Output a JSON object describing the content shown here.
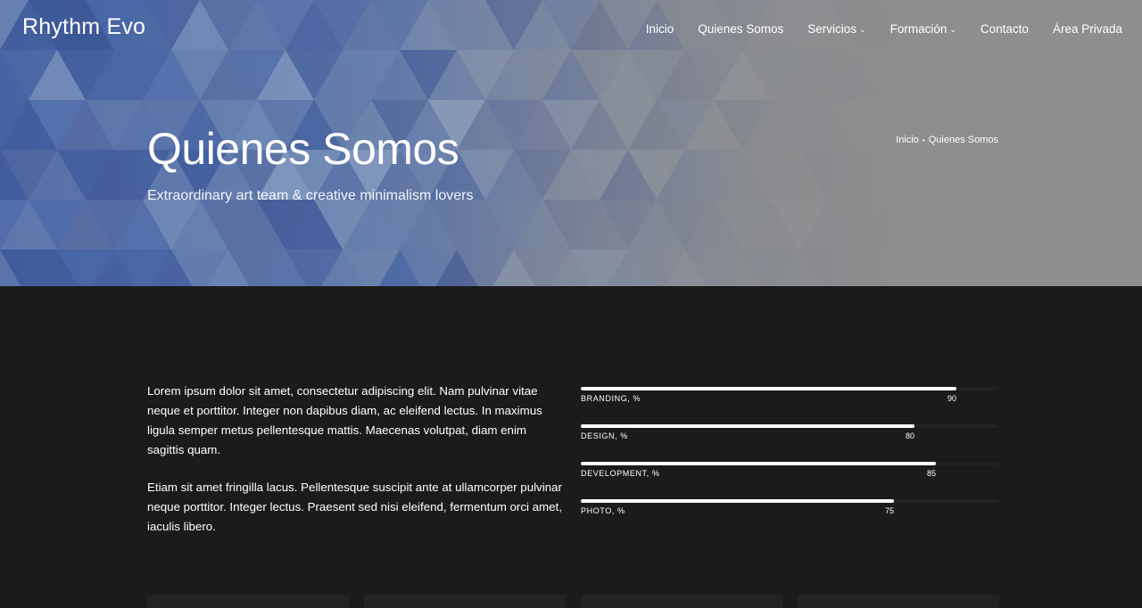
{
  "site": {
    "logo": "Rhythm Evo"
  },
  "nav": {
    "items": [
      {
        "label": "Inicio"
      },
      {
        "label": "Quienes Somos"
      },
      {
        "label": "Servicios",
        "has_dropdown": true
      },
      {
        "label": "Formación",
        "has_dropdown": true
      },
      {
        "label": "Contacto"
      },
      {
        "label": "Área Privada"
      }
    ],
    "dropdown_icon": "chevron-down-icon"
  },
  "hero": {
    "title": "Quienes Somos",
    "subtitle": "Extraordinary art team & creative minimalism lovers",
    "breadcrumb": {
      "home": "Inicio",
      "current": "Quienes Somos"
    }
  },
  "about": {
    "paragraphs": [
      "Lorem ipsum dolor sit amet, consectetur adipiscing elit. Nam pulvinar vitae neque et porttitor. Integer non dapibus diam, ac eleifend lectus. In maximus ligula semper metus pellentesque mattis. Maecenas volutpat, diam enim sagittis quam.",
      "Etiam sit amet fringilla lacus. Pellentesque suscipit ante at ullamcorper pulvinar neque porttitor. Integer lectus. Praesent sed nisi eleifend, fermentum orci amet, iaculis libero."
    ]
  },
  "skills": [
    {
      "label": "BRANDING, %",
      "value": 90,
      "value_text": "90"
    },
    {
      "label": "DESIGN, %",
      "value": 80,
      "value_text": "80"
    },
    {
      "label": "DEVELOPMENT, %",
      "value": 85,
      "value_text": "85"
    },
    {
      "label": "PHOTO, %",
      "value": 75,
      "value_text": "75"
    }
  ],
  "colors": {
    "background": "#1b1b1b",
    "hero_blue": "#4461a0",
    "hero_gray": "#8e8e8e",
    "bar_fill": "#ffffff"
  }
}
